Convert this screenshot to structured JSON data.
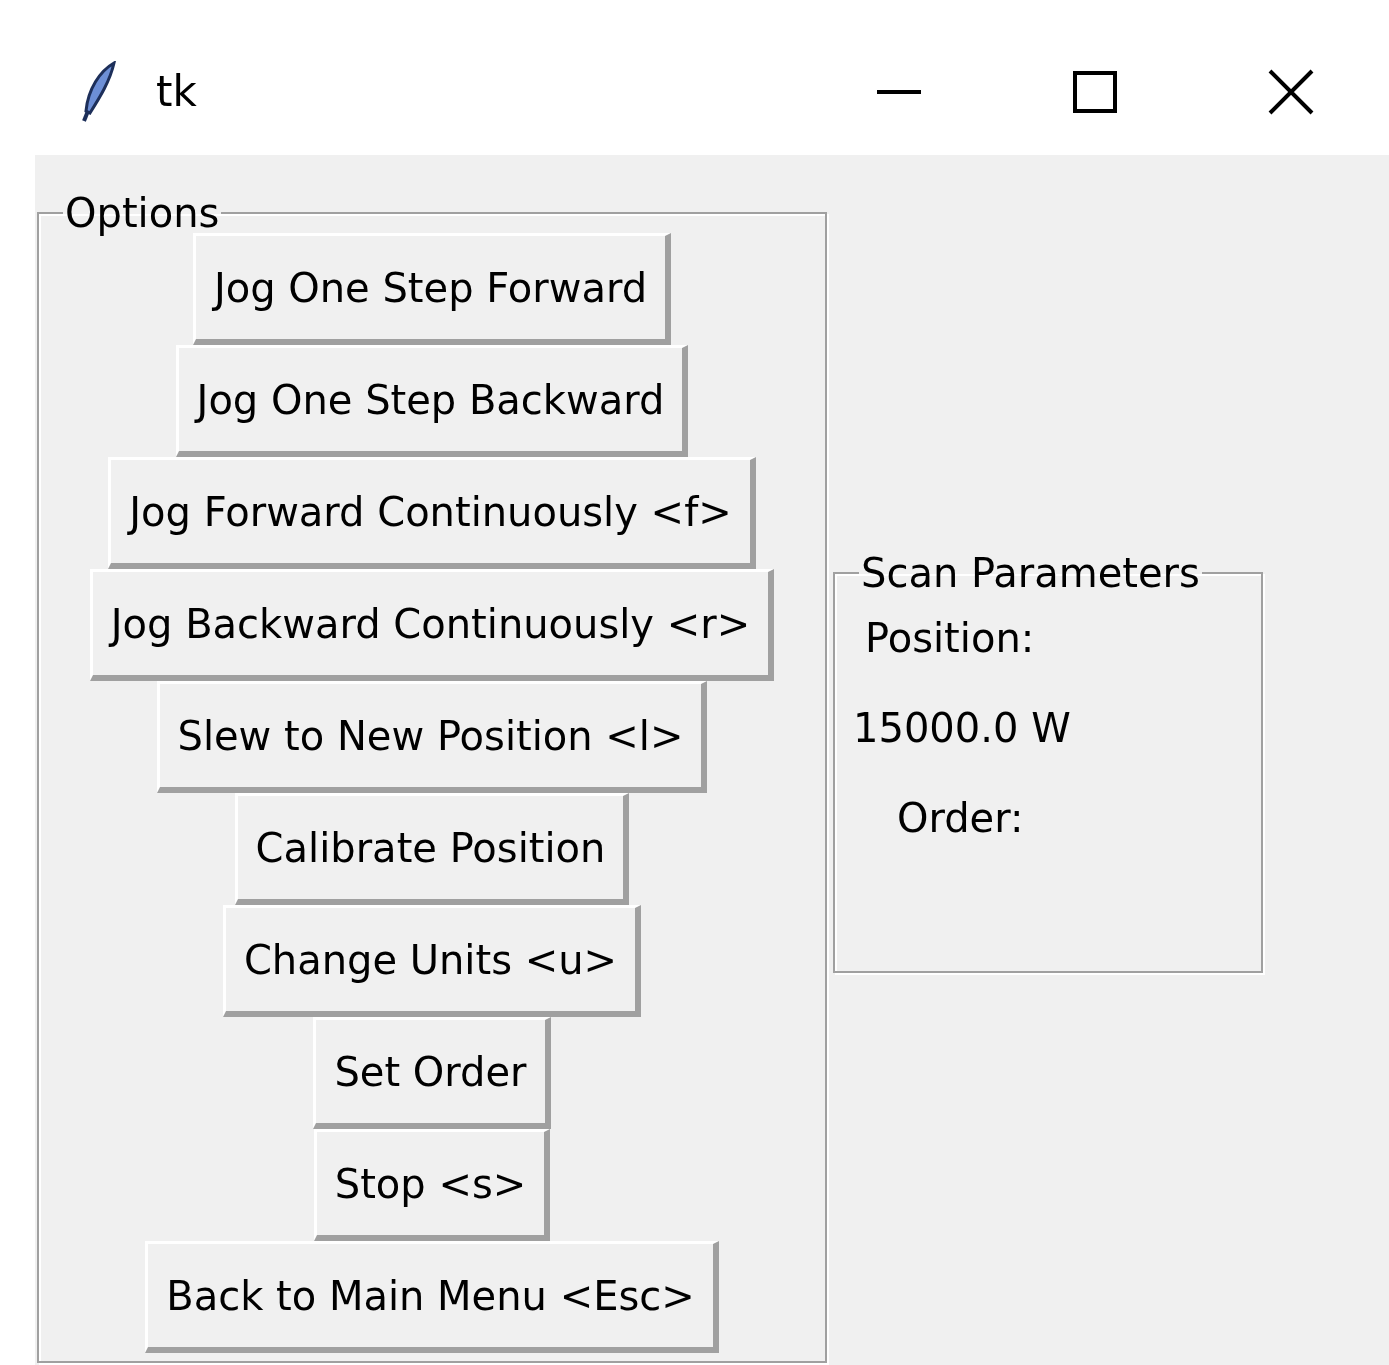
{
  "window": {
    "title": "tk"
  },
  "options": {
    "title": "Options",
    "buttons": [
      "Jog One Step Forward",
      "Jog One Step Backward",
      "Jog Forward Continuously <f>",
      "Jog Backward Continuously <r>",
      "Slew to New Position <l>",
      "Calibrate Position",
      "Change Units <u>",
      "Set Order",
      "Stop <s>",
      "Back to Main Menu <Esc>"
    ]
  },
  "scan_parameters": {
    "title": "Scan Parameters",
    "position_label": "Position:",
    "position_value": "15000.0 W",
    "order_label": "Order:"
  }
}
